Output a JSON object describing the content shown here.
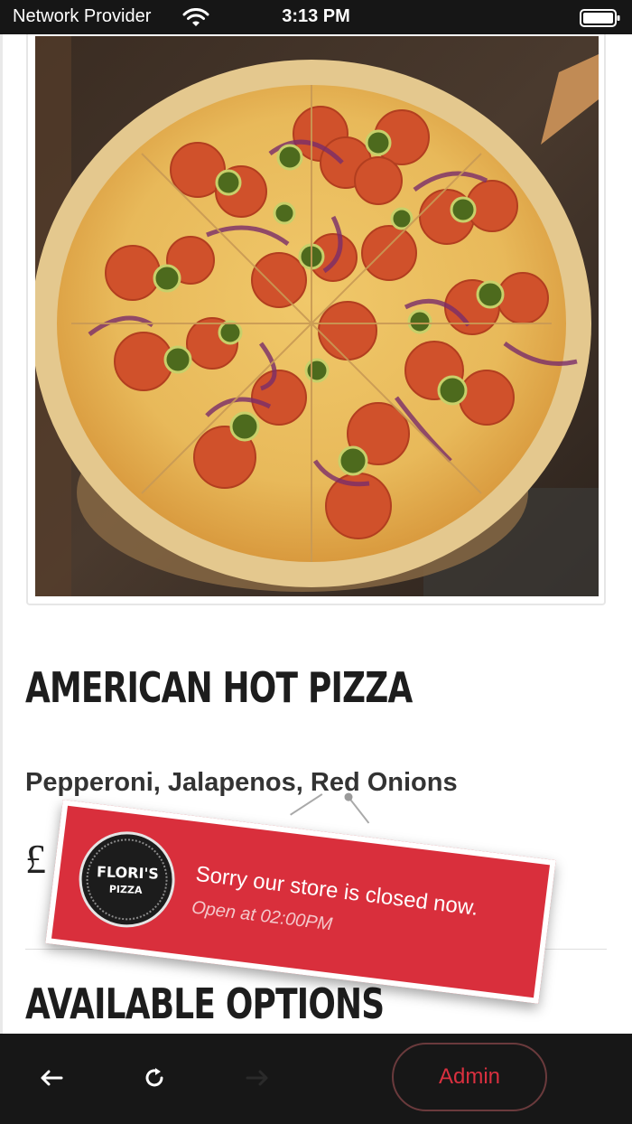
{
  "status_bar": {
    "carrier": "Network Provider",
    "time": "3:13 PM",
    "wifi_icon": "wifi-icon",
    "battery_icon": "battery-icon"
  },
  "product": {
    "title": "AMERICAN HOT PIZZA",
    "description": "Pepperoni, Jalapenos, Red Onions",
    "price_visible": "£",
    "options_heading": "AVAILABLE OPTIONS",
    "image": "pizza-photo"
  },
  "closed_banner": {
    "logo_brand": "FLORI'S",
    "logo_sub": "PIZZA",
    "message": "Sorry our store is closed now.",
    "reopen": "Open at 02:00PM",
    "color": "#d92f3c"
  },
  "bottom_bar": {
    "back_icon": "arrow-left-icon",
    "reload_icon": "reload-icon",
    "forward_icon": "arrow-right-icon",
    "admin_label": "Admin",
    "admin_color": "#d9303f"
  }
}
